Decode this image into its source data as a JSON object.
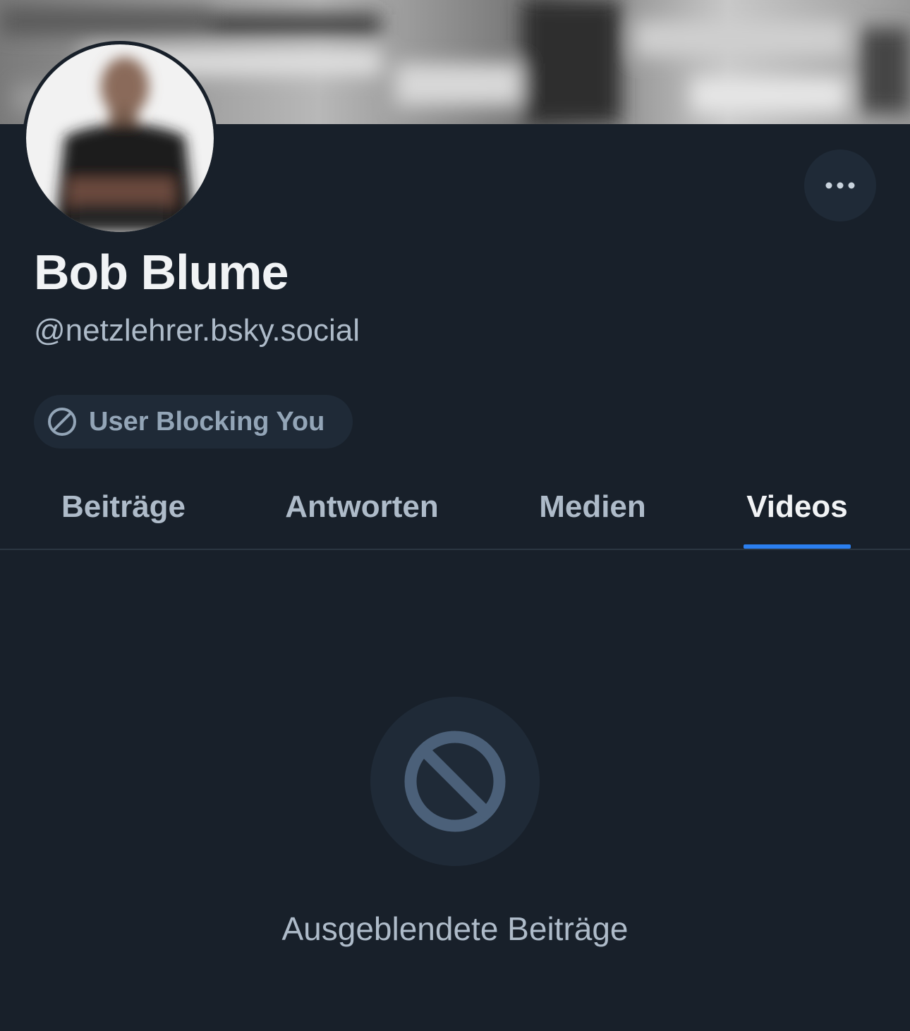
{
  "profile": {
    "display_name": "Bob Blume",
    "handle": "@netzlehrer.bsky.social",
    "banner_icon": "banner-image",
    "avatar_icon": "avatar-image"
  },
  "header_actions": {
    "more_icon": "ellipsis-icon"
  },
  "status": {
    "label": "User Blocking You",
    "icon": "block-icon"
  },
  "tabs": [
    {
      "label": "Beiträge",
      "active": false
    },
    {
      "label": "Antworten",
      "active": false
    },
    {
      "label": "Medien",
      "active": false
    },
    {
      "label": "Videos",
      "active": true
    }
  ],
  "empty_state": {
    "icon": "block-icon",
    "message": "Ausgeblendete Beiträge"
  },
  "colors": {
    "background": "#18202a",
    "surface": "#1f2a37",
    "accent": "#2b7fef",
    "text_primary": "#f1f3f5",
    "text_secondary": "#aebbc9",
    "icon_muted": "#4b6079"
  }
}
